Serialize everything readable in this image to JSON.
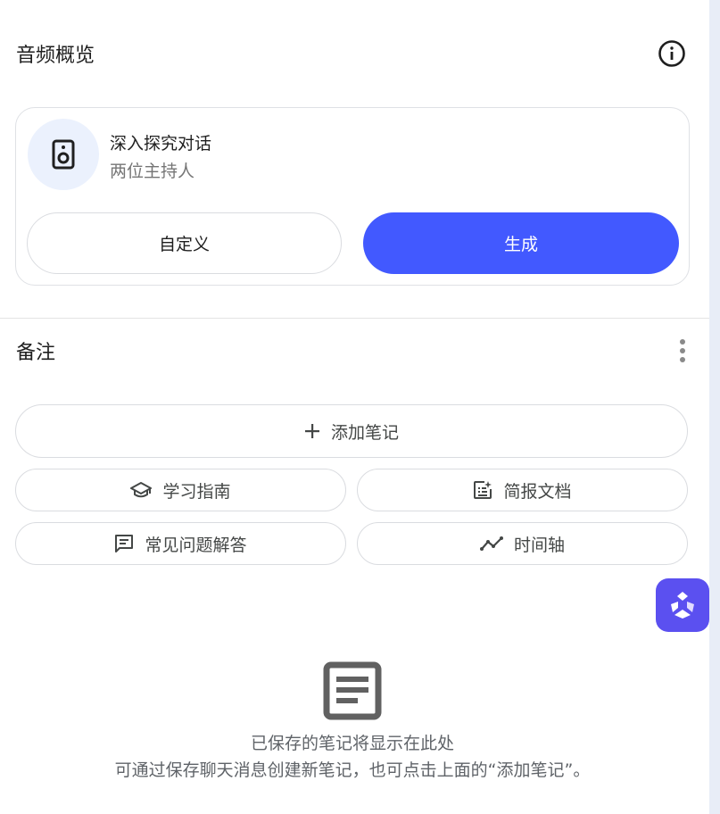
{
  "audio_overview": {
    "title": "音频概览",
    "info_icon": "info-icon",
    "card": {
      "icon": "speaker-icon",
      "title": "深入探究对话",
      "subtitle": "两位主持人",
      "customize_label": "自定义",
      "generate_label": "生成"
    }
  },
  "notes": {
    "title": "备注",
    "more_icon": "more-vert-icon",
    "add_note_label": "添加笔记",
    "actions": [
      {
        "label": "学习指南",
        "icon": "school-icon"
      },
      {
        "label": "简报文档",
        "icon": "briefing-doc-icon"
      },
      {
        "label": "常见问题解答",
        "icon": "faq-icon"
      },
      {
        "label": "时间轴",
        "icon": "timeline-icon"
      }
    ],
    "empty_state": {
      "icon": "note-icon",
      "line1": "已保存的笔记将显示在此处",
      "line2": "可通过保存聊天消息创建新笔记，也可点击上面的“添加笔记”。"
    }
  },
  "colors": {
    "accent": "#4259ff",
    "assistant_fab": "#5b50f0",
    "speaker_bg": "#ebf1fd"
  }
}
